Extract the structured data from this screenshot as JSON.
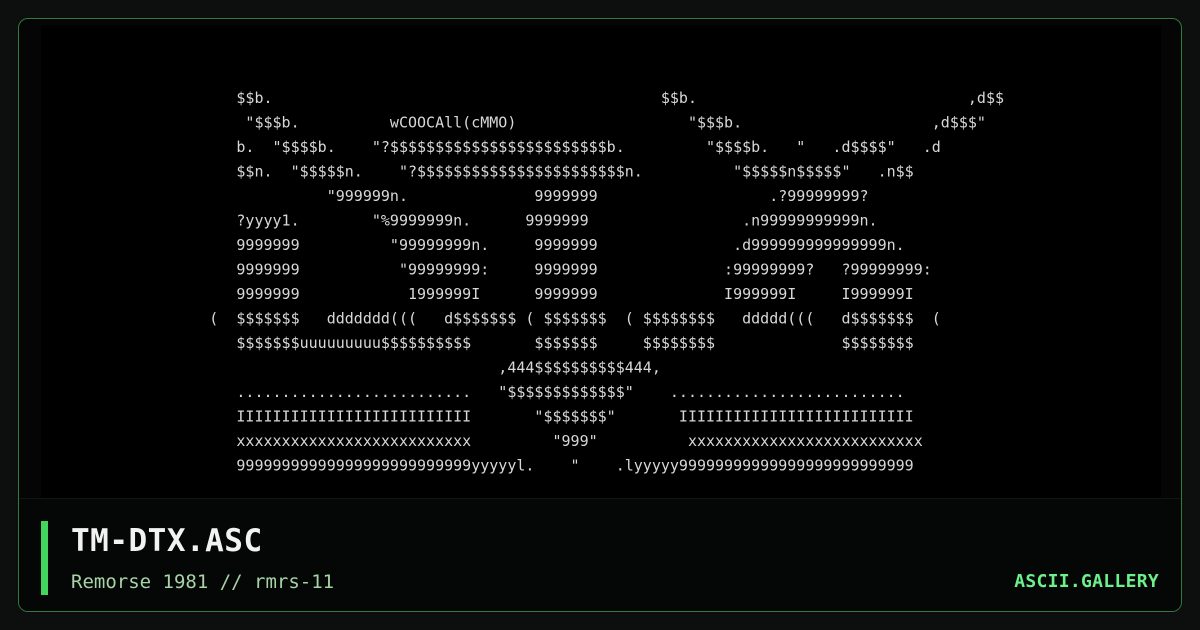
{
  "artwork": {
    "lines": [
      "             $$b.                                           $$b.                              ,d$$",
      "              \"$$$b.          wCOOCAll(cMMO)                   \"$$$b.                     ,d$$$\"",
      "             b.  \"$$$$b.    \"?$$$$$$$$$$$$$$$$$$$$$$$$b.         \"$$$$b.   \"   .d$$$$\"   .d",
      "             $$n.  \"$$$$$n.    \"?$$$$$$$$$$$$$$$$$$$$$$$n.          \"$$$$$n$$$$$\"   .n$$",
      "                       \"999999n.              9999999                   .?99999999?",
      "             ?yyyy1.        \"%9999999n.      9999999                 .n99999999999n.",
      "             9999999          \"99999999n.     9999999               .d999999999999999n.",
      "             9999999           \"99999999:     9999999              :99999999?   ?99999999:",
      "             9999999            1999999I      9999999              I999999I     I999999I",
      "          (  $$$$$$$   ddddddd(((   d$$$$$$$ ( $$$$$$$  ( $$$$$$$$   ddddd(((   d$$$$$$$  (",
      "             $$$$$$$uuuuuuuuu$$$$$$$$$$       $$$$$$$     $$$$$$$$              $$$$$$$$",
      "                                          ,444$$$$$$$$$$444,",
      "             ..........................   \"$$$$$$$$$$$$$\"    ..........................",
      "             IIIIIIIIIIIIIIIIIIIIIIIIII       \"$$$$$$$\"       IIIIIIIIIIIIIIIIIIIIIIIIII",
      "             xxxxxxxxxxxxxxxxxxxxxxxxxx         \"999\"          xxxxxxxxxxxxxxxxxxxxxxxxxx",
      "             99999999999999999999999999yyyyyl.    \"    .lyyyyy99999999999999999999999999"
    ]
  },
  "footer": {
    "title": "TM-DTX.ASC",
    "subtitle": "Remorse 1981 // rmrs-11",
    "brand": "ASCII.GALLERY"
  },
  "colors": {
    "accent": "#44d55f",
    "brand": "#6cf08b",
    "subtitle": "#a7d3a6",
    "art_text": "#d8d8d8"
  }
}
